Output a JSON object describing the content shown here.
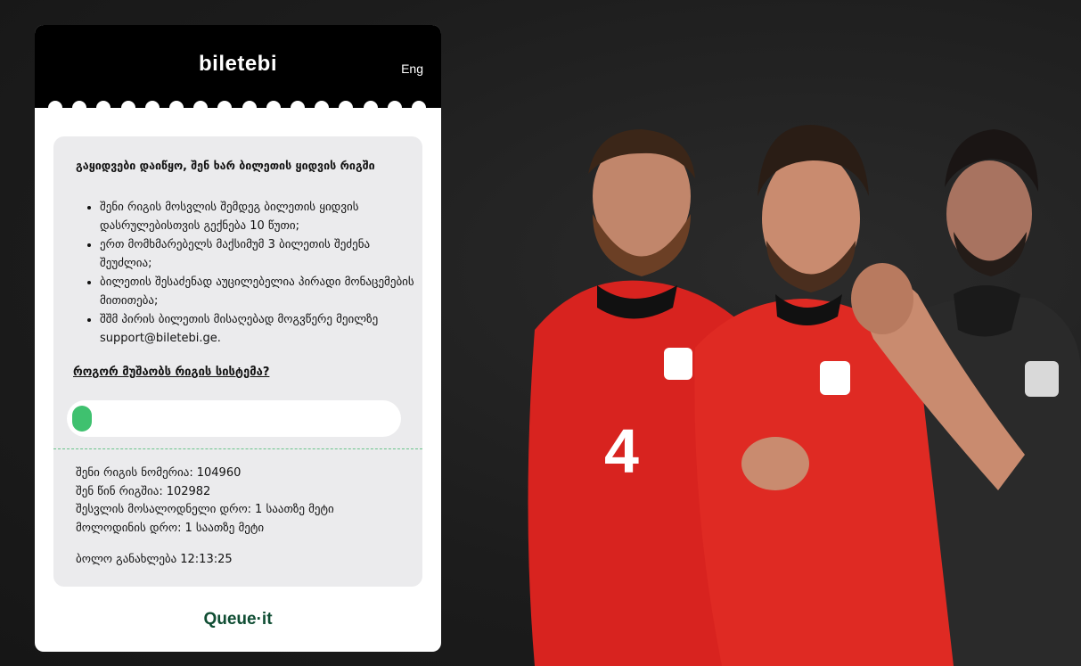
{
  "header": {
    "logo_text": "biletebi",
    "language_label": "Eng"
  },
  "queue": {
    "title": "გაყიდვები დაიწყო, შენ ხარ ბილეთის ყიდვის რიგში",
    "rules": [
      "შენი რიგის მოსვლის შემდეგ ბილეთის ყიდვის დასრულებისთვის გექნება 10 წუთი;",
      "ერთ მომხმარებელს მაქსიმუმ 3 ბილეთის შეძენა შეუძლია;",
      "ბილეთის შესაძენად აუცილებელია პირადი მონაცემების მითითება;",
      "შშმ პირის ბილეთის მისაღებად მოგვწერე მეილზე support@biletebi.ge."
    ],
    "how_link": "როგორ მუშაობს რიგის სისტემა?",
    "progress_fraction": 0.06,
    "queue_number_label": "შენი რიგის ნომერია:",
    "queue_number": "104960",
    "ahead_label": "შენ წინ რიგშია:",
    "ahead": "102982",
    "expected_label": "შესვლის მოსალოდნელი დრო:",
    "expected": "1 საათზე მეტი",
    "wait_label": "მოლოდინის დრო:",
    "wait": "1 საათზე მეტი",
    "updated_label": "ბოლო განახლება",
    "updated": "12:13:25"
  },
  "footer": {
    "brand": "Queue·it"
  },
  "colors": {
    "accent": "#3fc16f",
    "brand_dark": "#0f4d33",
    "jersey_red": "#d8231f"
  }
}
